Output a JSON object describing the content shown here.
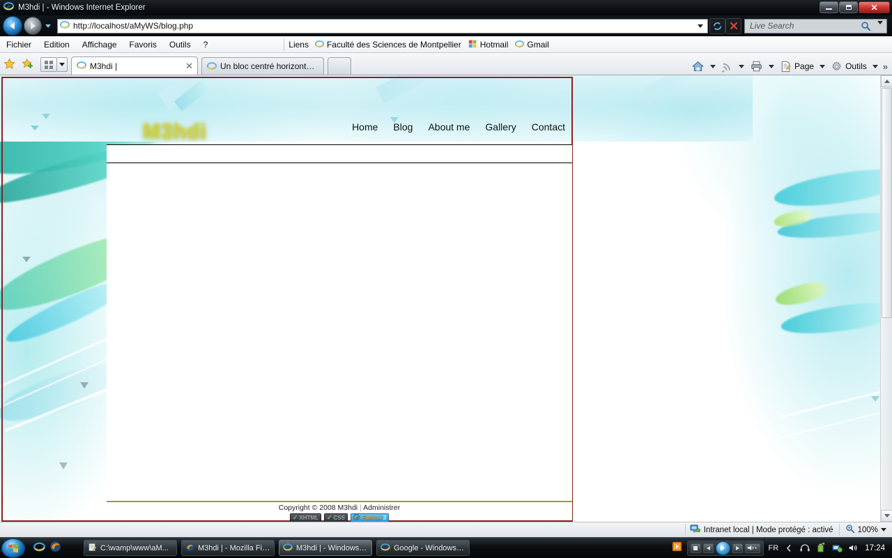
{
  "window": {
    "title": "M3hdi | - Windows Internet Explorer",
    "minimize_label": "Minimize",
    "maximize_label": "Maximize",
    "close_label": "Close"
  },
  "navbar": {
    "back_label": "Back",
    "forward_label": "Forward",
    "history_label": "Recent Pages",
    "address_value": "http://localhost/aMyWS/blog.php",
    "refresh_label": "Refresh",
    "stop_label": "Stop",
    "search_placeholder": "Live Search",
    "search_value": ""
  },
  "menubar": {
    "items": [
      {
        "label": "Fichier"
      },
      {
        "label": "Edition"
      },
      {
        "label": "Affichage"
      },
      {
        "label": "Favoris"
      },
      {
        "label": "Outils"
      },
      {
        "label": "?"
      }
    ],
    "links_label": "Liens",
    "favorites": [
      {
        "label": "Faculté des Sciences de Montpellier",
        "icon": "ie-icon"
      },
      {
        "label": "Hotmail",
        "icon": "windows-icon"
      },
      {
        "label": "Gmail",
        "icon": "ie-icon"
      }
    ]
  },
  "tabbar": {
    "add_favorite_label": "Add to Favorites",
    "favorites_center_label": "Favorites Center",
    "quick_tabs_label": "Quick Tabs",
    "tabs": [
      {
        "label": "M3hdi |",
        "active": true,
        "close_glyph": "✕"
      },
      {
        "label": "Un bloc centré horizontale...",
        "active": false
      },
      {
        "label": "",
        "newtab": true
      }
    ],
    "right_buttons": [
      {
        "label": "",
        "icon": "home-icon"
      },
      {
        "label": "",
        "icon": "rss-icon"
      },
      {
        "label": "",
        "icon": "print-icon"
      },
      {
        "label": "Page",
        "icon": "page-icon"
      },
      {
        "label": "Outils",
        "icon": "gear-icon"
      }
    ],
    "overflow_glyph": "»"
  },
  "page": {
    "logo_text": "M3hdi",
    "nav": [
      {
        "label": "Home"
      },
      {
        "label": "Blog"
      },
      {
        "label": "About me"
      },
      {
        "label": "Gallery"
      },
      {
        "label": "Contact"
      }
    ],
    "footer": {
      "copyright": "Copyright © 2008 M3hdi",
      "separator": "|",
      "admin_label": "Administrer",
      "badges": [
        {
          "check": "✓",
          "label": "XHTML",
          "type": "dark"
        },
        {
          "check": "✓",
          "label": "CSS",
          "type": "dark"
        },
        {
          "label": "Firefox",
          "version": "3",
          "type": "firefox"
        }
      ]
    },
    "colors": {
      "border": "#8d2020",
      "footer_rule": "#9aa617",
      "logo": "#cfd243",
      "art_teal": "#3fc8cf"
    }
  },
  "statusbar": {
    "zone_text": "Intranet local | Mode protégé : activé",
    "zoom_level": "100%"
  },
  "taskbar": {
    "start_label": "Start",
    "quick_launch": [
      {
        "icon": "ie-icon",
        "label": "Internet Explorer"
      },
      {
        "icon": "firefox-icon",
        "label": "Mozilla Firefox"
      }
    ],
    "tasks": [
      {
        "label": "C:\\wamp\\www\\aM...",
        "icon": "notepad-icon",
        "active": false
      },
      {
        "label": "M3hdi | - Mozilla Fir...",
        "icon": "firefox-icon",
        "active": false
      },
      {
        "label": "M3hdi | - Windows I...",
        "icon": "ie-icon",
        "active": true
      },
      {
        "label": "Google - Windows I...",
        "icon": "ie-icon",
        "active": false
      }
    ],
    "tray": {
      "language": "FR",
      "clock": "17:24",
      "icons": [
        {
          "name": "chevron-left-icon"
        },
        {
          "name": "headset-icon"
        },
        {
          "name": "battery-icon"
        },
        {
          "name": "network-icon"
        },
        {
          "name": "volume-icon"
        }
      ]
    }
  }
}
